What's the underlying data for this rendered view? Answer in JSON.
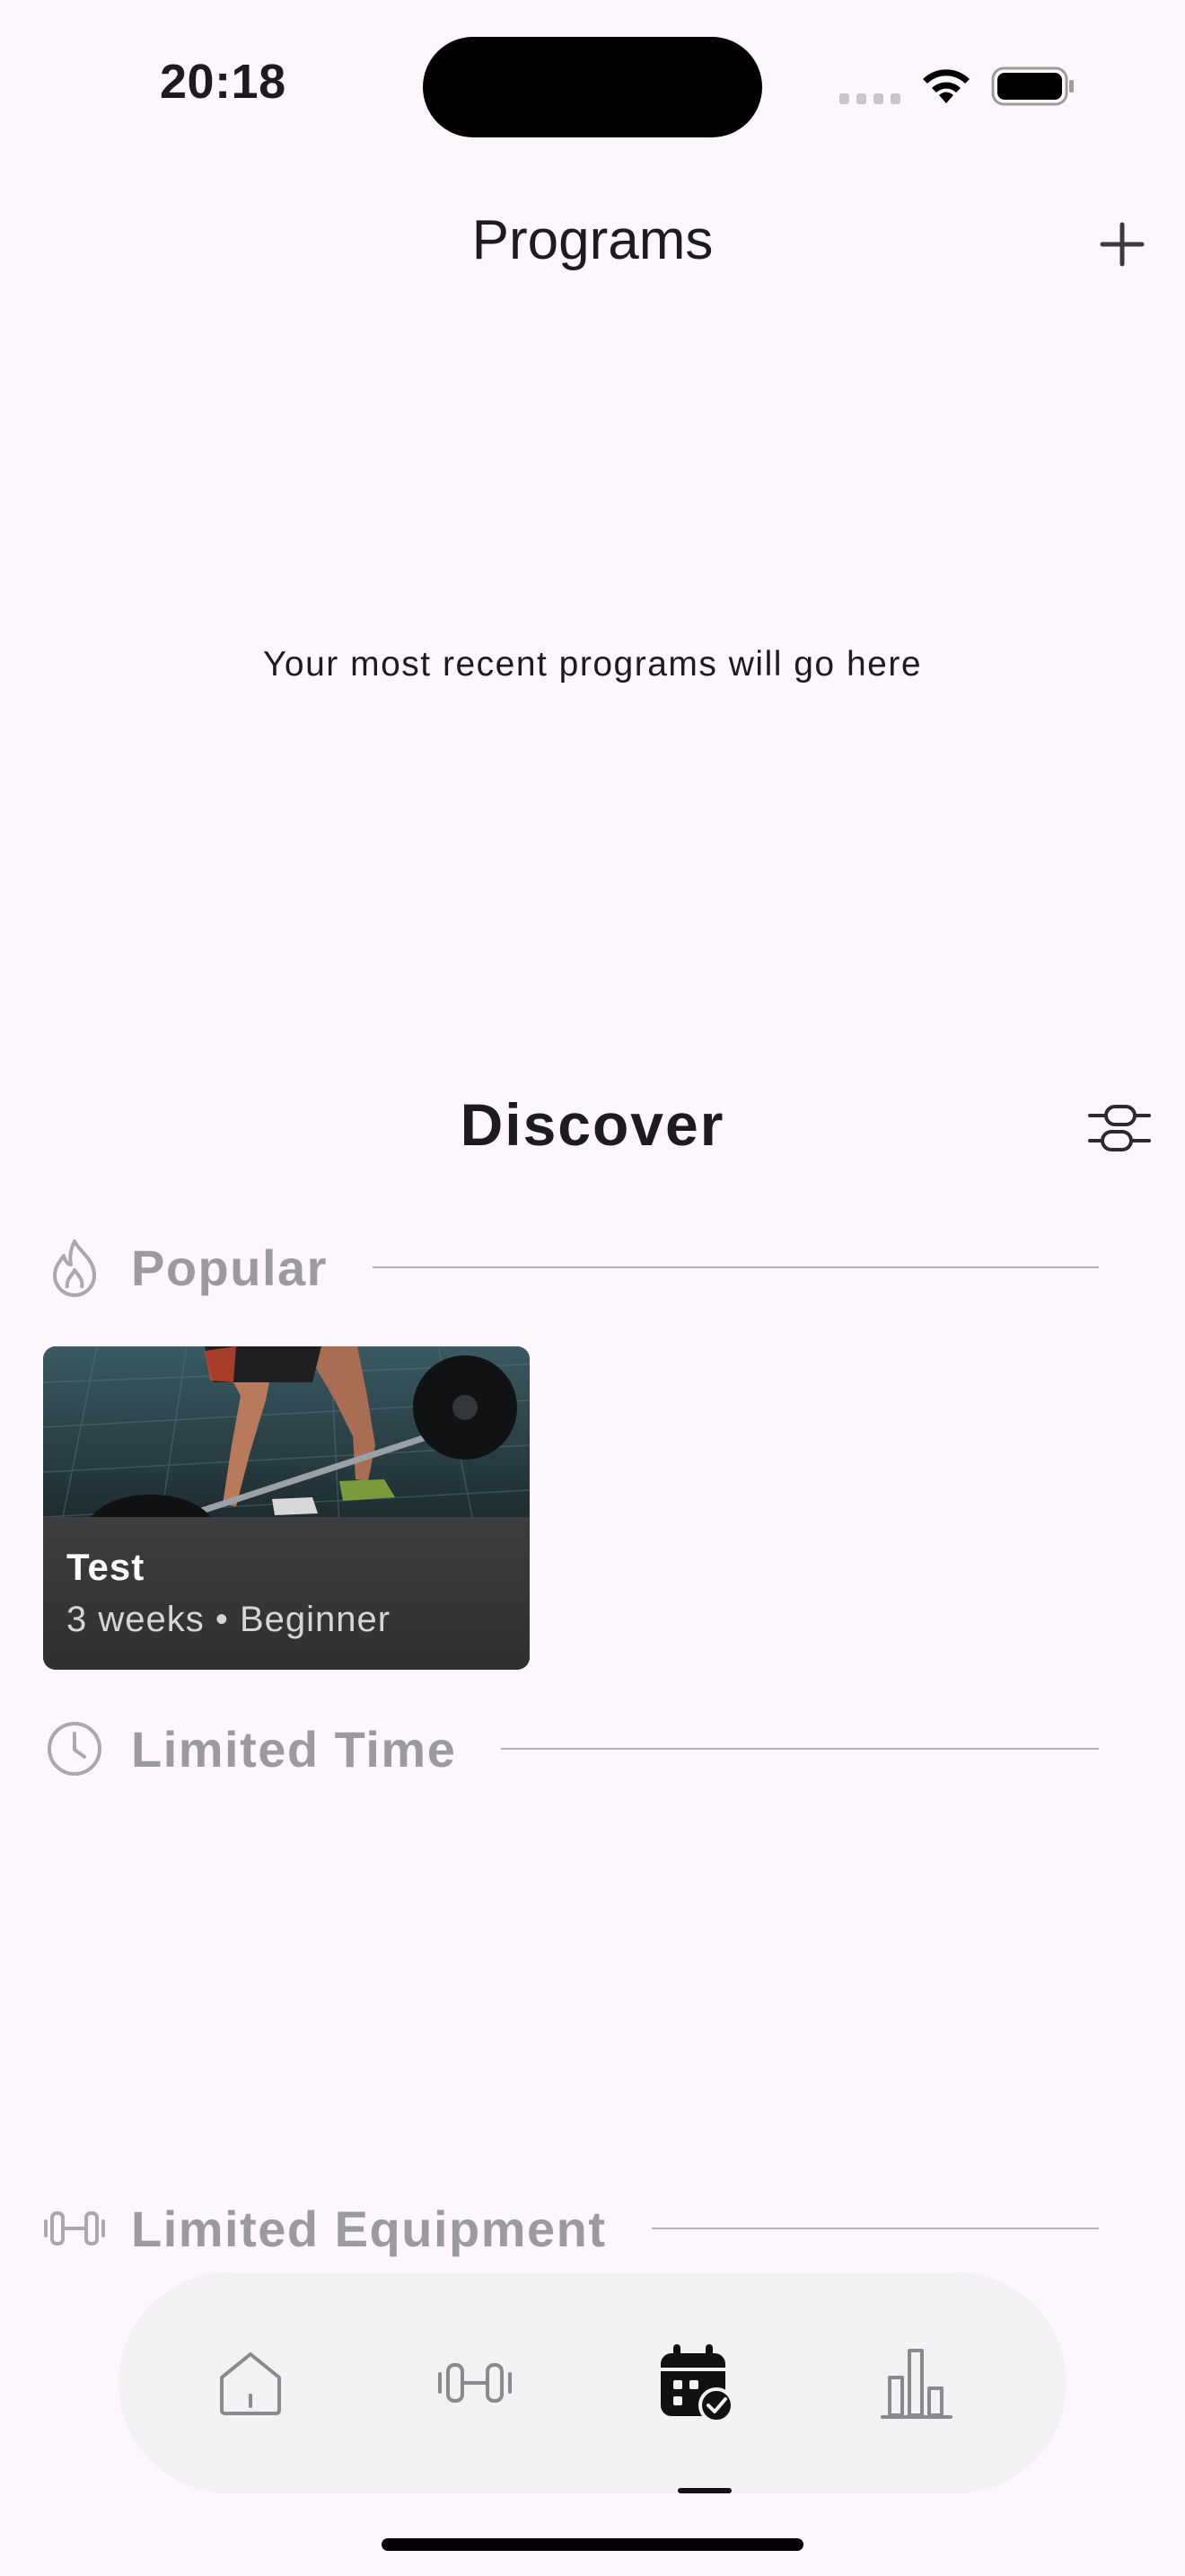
{
  "status_bar": {
    "time": "20:18"
  },
  "header": {
    "title": "Programs",
    "add_icon": "plus-icon"
  },
  "recent_programs": {
    "empty_text": "Your most recent programs will go here"
  },
  "discover": {
    "title": "Discover",
    "filter_icon": "filter-sliders-icon",
    "sections": [
      {
        "label": "Popular",
        "icon": "flame-icon"
      },
      {
        "label": "Limited Time",
        "icon": "clock-icon"
      },
      {
        "label": "Limited Equipment",
        "icon": "dumbbell-icon"
      }
    ],
    "popular_cards": [
      {
        "title": "Test",
        "subtitle": "3 weeks • Beginner",
        "image": "barbell-deadlift-photo"
      }
    ]
  },
  "bottom_nav": {
    "items": [
      {
        "icon": "home-icon",
        "active": false
      },
      {
        "icon": "dumbbell-icon",
        "active": false
      },
      {
        "icon": "calendar-check-icon",
        "active": true
      },
      {
        "icon": "bar-chart-icon",
        "active": false
      }
    ]
  },
  "colors": {
    "background": "#fdf7fd",
    "section_text": "#9b9a9e",
    "nav_background": "#f2f2f4"
  }
}
